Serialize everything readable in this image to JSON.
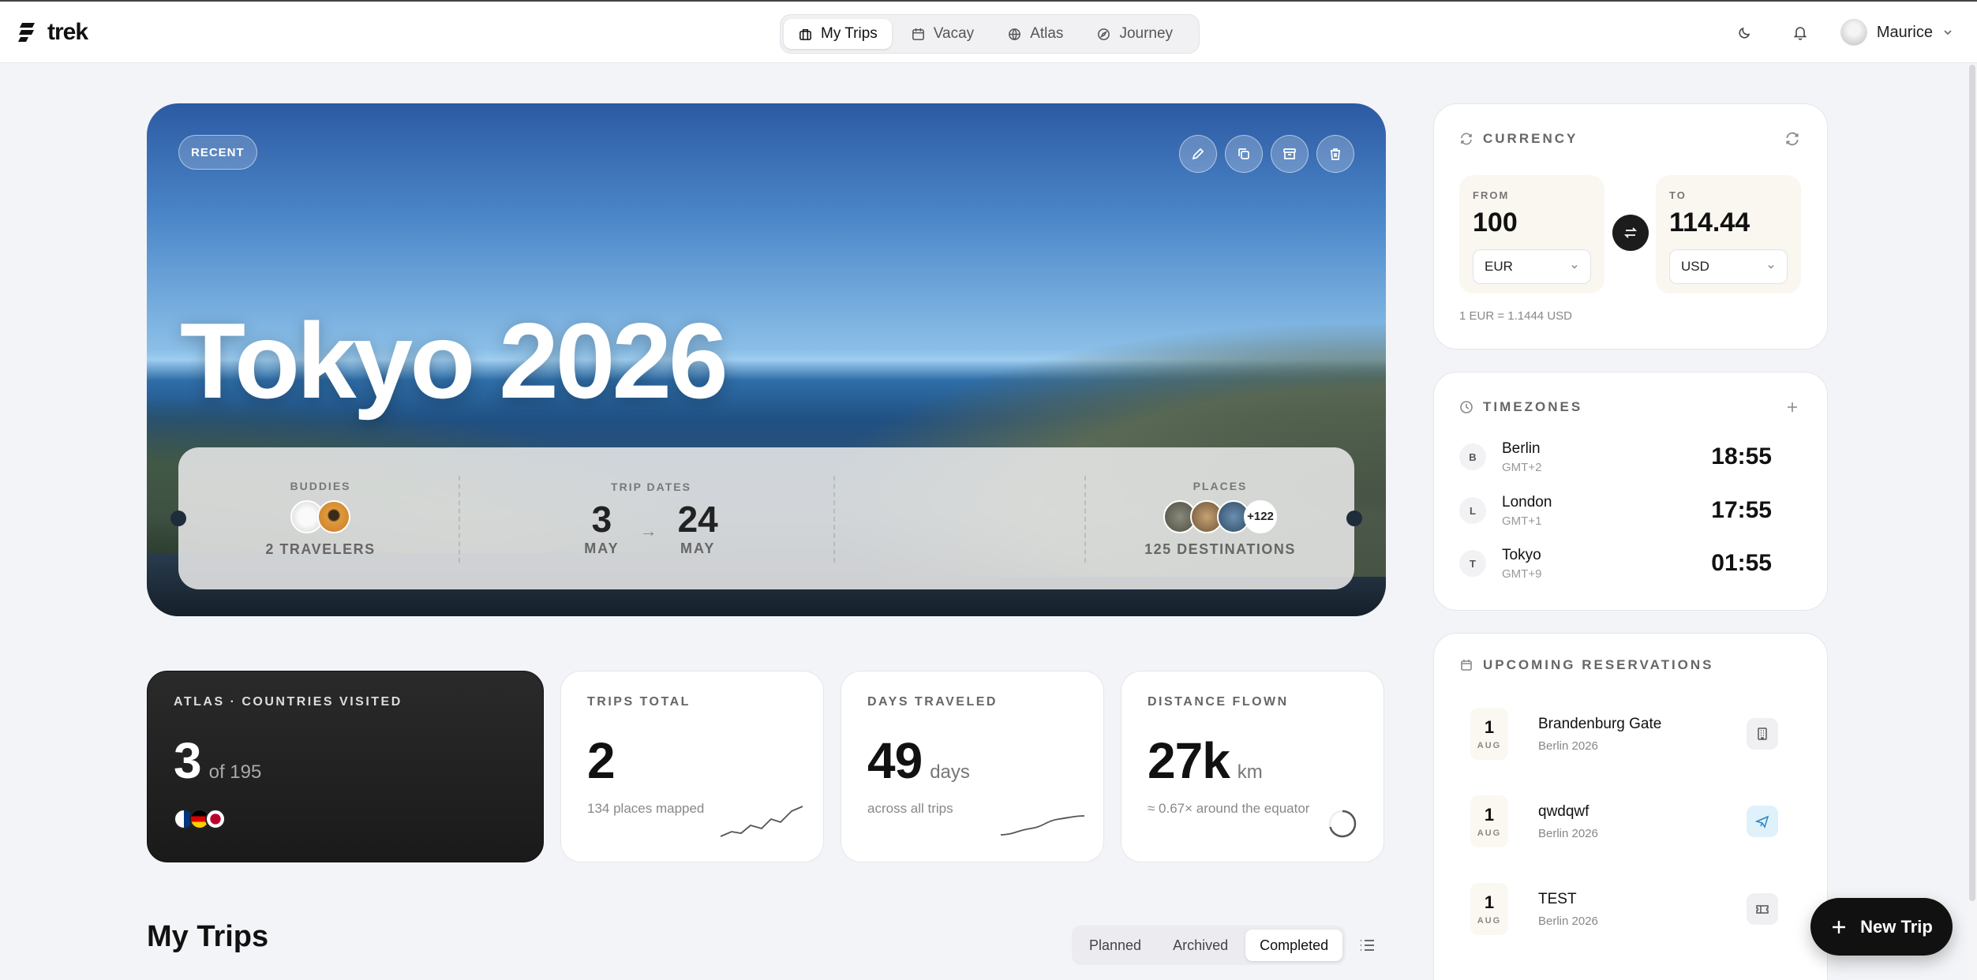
{
  "app": {
    "name": "trek"
  },
  "nav": {
    "items": [
      {
        "label": "My Trips",
        "icon": "suitcase-icon"
      },
      {
        "label": "Vacay",
        "icon": "calendar-icon"
      },
      {
        "label": "Atlas",
        "icon": "globe-icon"
      },
      {
        "label": "Journey",
        "icon": "compass-icon"
      }
    ],
    "active": "My Trips"
  },
  "user": {
    "name": "Maurice"
  },
  "hero": {
    "badge": "RECENT",
    "title": "Tokyo 2026",
    "buddies_label": "BUDDIES",
    "travelers": "2 TRAVELERS",
    "dates_label": "TRIP DATES",
    "start_day": "3",
    "start_month": "MAY",
    "end_day": "24",
    "end_month": "MAY",
    "places_label": "PLACES",
    "places_more": "+122",
    "destinations": "125 DESTINATIONS"
  },
  "stats": {
    "atlas": {
      "label": "ATLAS · COUNTRIES VISITED",
      "value": "3",
      "unit": "of 195"
    },
    "trips": {
      "label": "TRIPS TOTAL",
      "value": "2",
      "sub": "134 places mapped"
    },
    "days": {
      "label": "DAYS TRAVELED",
      "value": "49",
      "unit": "days",
      "sub": "across all trips"
    },
    "distance": {
      "label": "DISTANCE FLOWN",
      "value": "27k",
      "unit": "km",
      "sub": "≈ 0.67× around the equator"
    }
  },
  "trips": {
    "title": "My Trips",
    "filters": [
      "Planned",
      "Archived",
      "Completed"
    ],
    "active_filter": "Completed"
  },
  "currency": {
    "title": "CURRENCY",
    "from_label": "FROM",
    "from_value": "100",
    "from_code": "EUR",
    "to_label": "TO",
    "to_value": "114.44",
    "to_code": "USD",
    "rate": "1 EUR = 1.1444 USD"
  },
  "timezones": {
    "title": "TIMEZONES",
    "items": [
      {
        "initial": "B",
        "city": "Berlin",
        "offset": "GMT+2",
        "time": "18:55"
      },
      {
        "initial": "L",
        "city": "London",
        "offset": "GMT+1",
        "time": "17:55"
      },
      {
        "initial": "T",
        "city": "Tokyo",
        "offset": "GMT+9",
        "time": "01:55"
      }
    ]
  },
  "reservations": {
    "title": "UPCOMING RESERVATIONS",
    "items": [
      {
        "day": "1",
        "month": "AUG",
        "title": "Brandenburg Gate",
        "trip": "Berlin 2026",
        "icon": "building-icon"
      },
      {
        "day": "1",
        "month": "AUG",
        "title": "qwdqwf",
        "trip": "Berlin 2026",
        "icon": "plane-icon"
      },
      {
        "day": "1",
        "month": "AUG",
        "title": "TEST",
        "trip": "Berlin 2026",
        "icon": "ticket-icon"
      }
    ]
  },
  "fab": {
    "label": "New Trip"
  }
}
